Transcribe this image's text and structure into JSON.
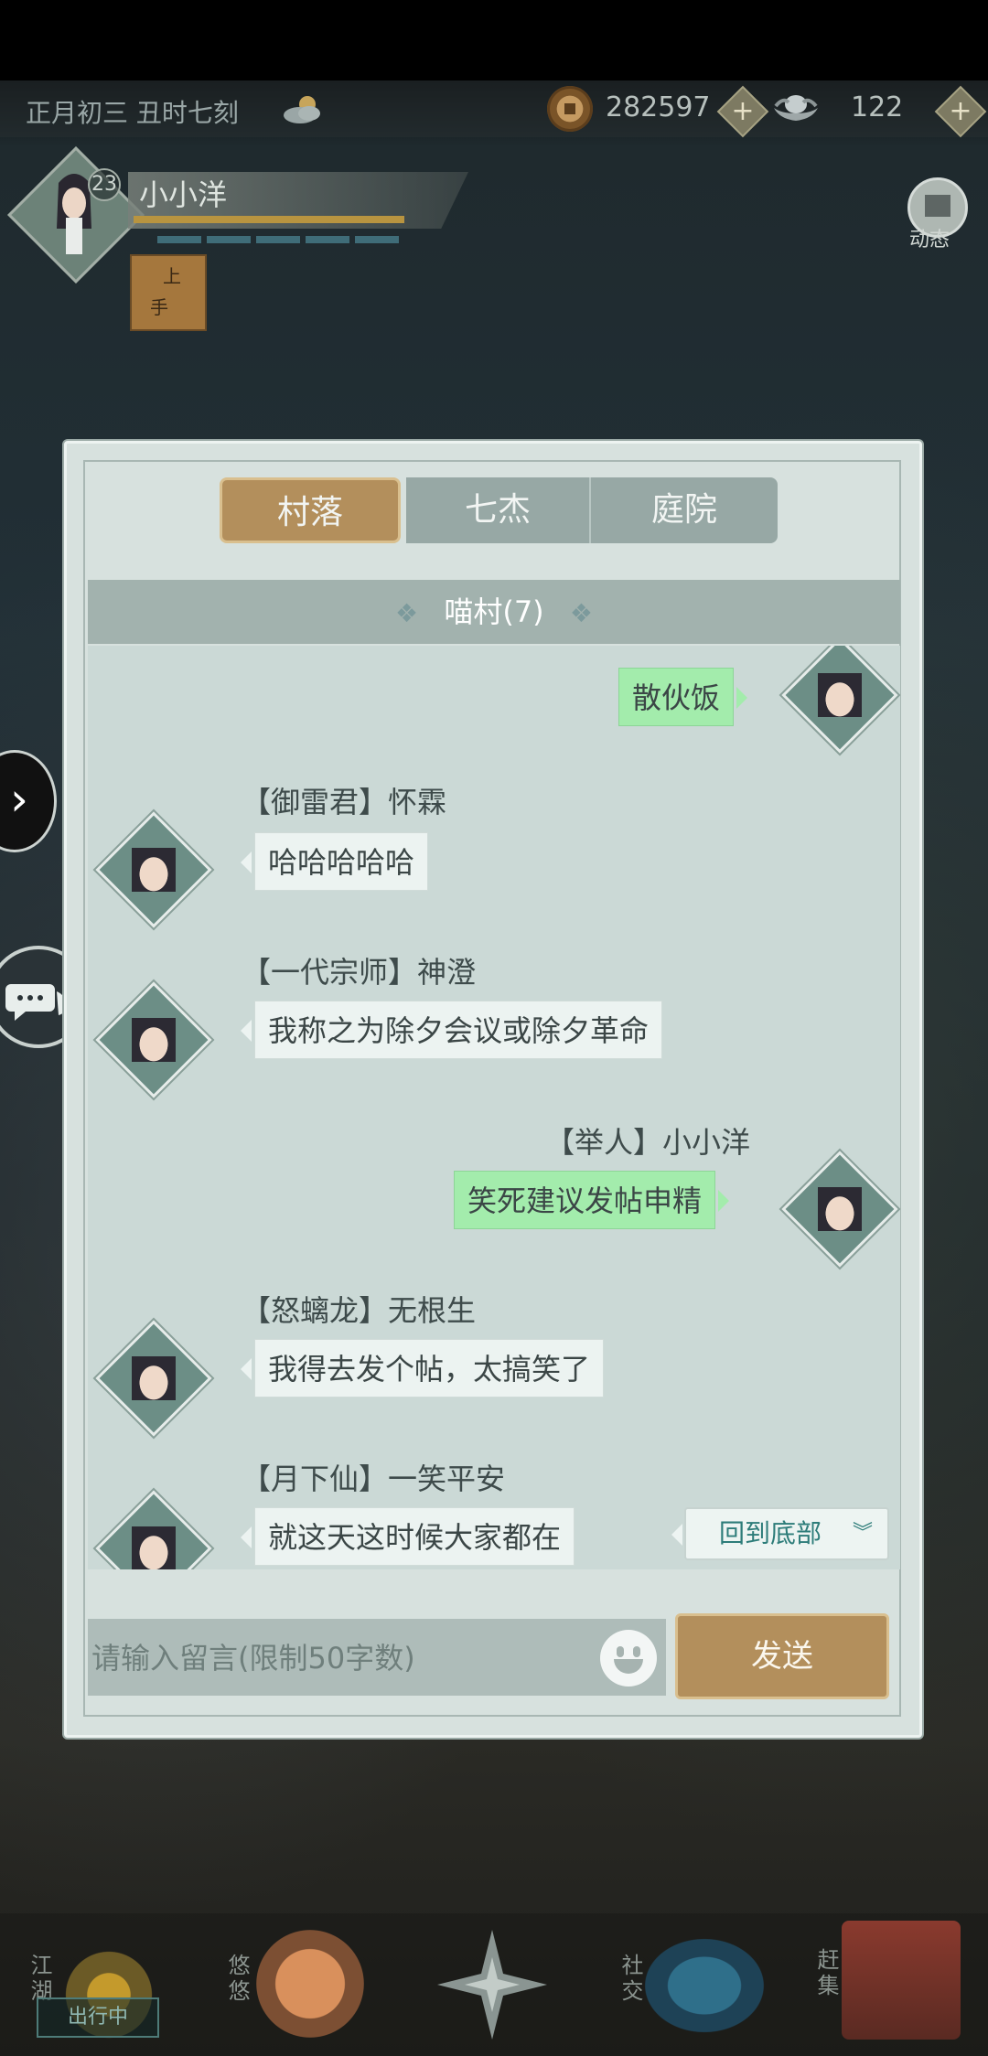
{
  "status_bar": {
    "datetime": "正月初三  丑时七刻",
    "weather_icon": "cloudy-sun-icon",
    "copper_coins": "282597",
    "silver_ingots": "122",
    "plus_label": "+"
  },
  "player": {
    "level": "23",
    "name": "小小洋",
    "dynamic_label": "动态"
  },
  "chat": {
    "tabs": [
      {
        "label": "村落"
      },
      {
        "label": "七杰"
      },
      {
        "label": "庭院"
      }
    ],
    "room_title": "喵村(7)",
    "messages": [
      {
        "side": "right",
        "name": "",
        "text": "散伙饭"
      },
      {
        "side": "left",
        "name": "【御雷君】怀霖",
        "text": "哈哈哈哈哈"
      },
      {
        "side": "left",
        "name": "【一代宗师】神澄",
        "text": "我称之为除夕会议或除夕革命"
      },
      {
        "side": "right",
        "name": "【举人】小小洋",
        "text": "笑死建议发帖申精"
      },
      {
        "side": "left",
        "name": "【怒螭龙】无根生",
        "text": "我得去发个帖，太搞笑了"
      },
      {
        "side": "left",
        "name": "【月下仙】一笑平安",
        "text": "就这天这时候大家都在"
      }
    ],
    "back_to_bottom": "回到底部",
    "back_icon": "double-chevron-down-icon",
    "input_placeholder": "请输入留言(限制50字数)",
    "send_label": "发送"
  },
  "bottom_nav": {
    "items": [
      {
        "label": "江湖"
      },
      {
        "label": "悠悠"
      },
      {
        "label": "社交"
      },
      {
        "label": "赶集"
      }
    ],
    "status_tag": "出行中"
  },
  "colors": {
    "accent_gold": "#b38f5c",
    "panel_bg": "#d7e1de",
    "my_bubble": "#a3ecac",
    "link_teal": "#2d7c79"
  }
}
